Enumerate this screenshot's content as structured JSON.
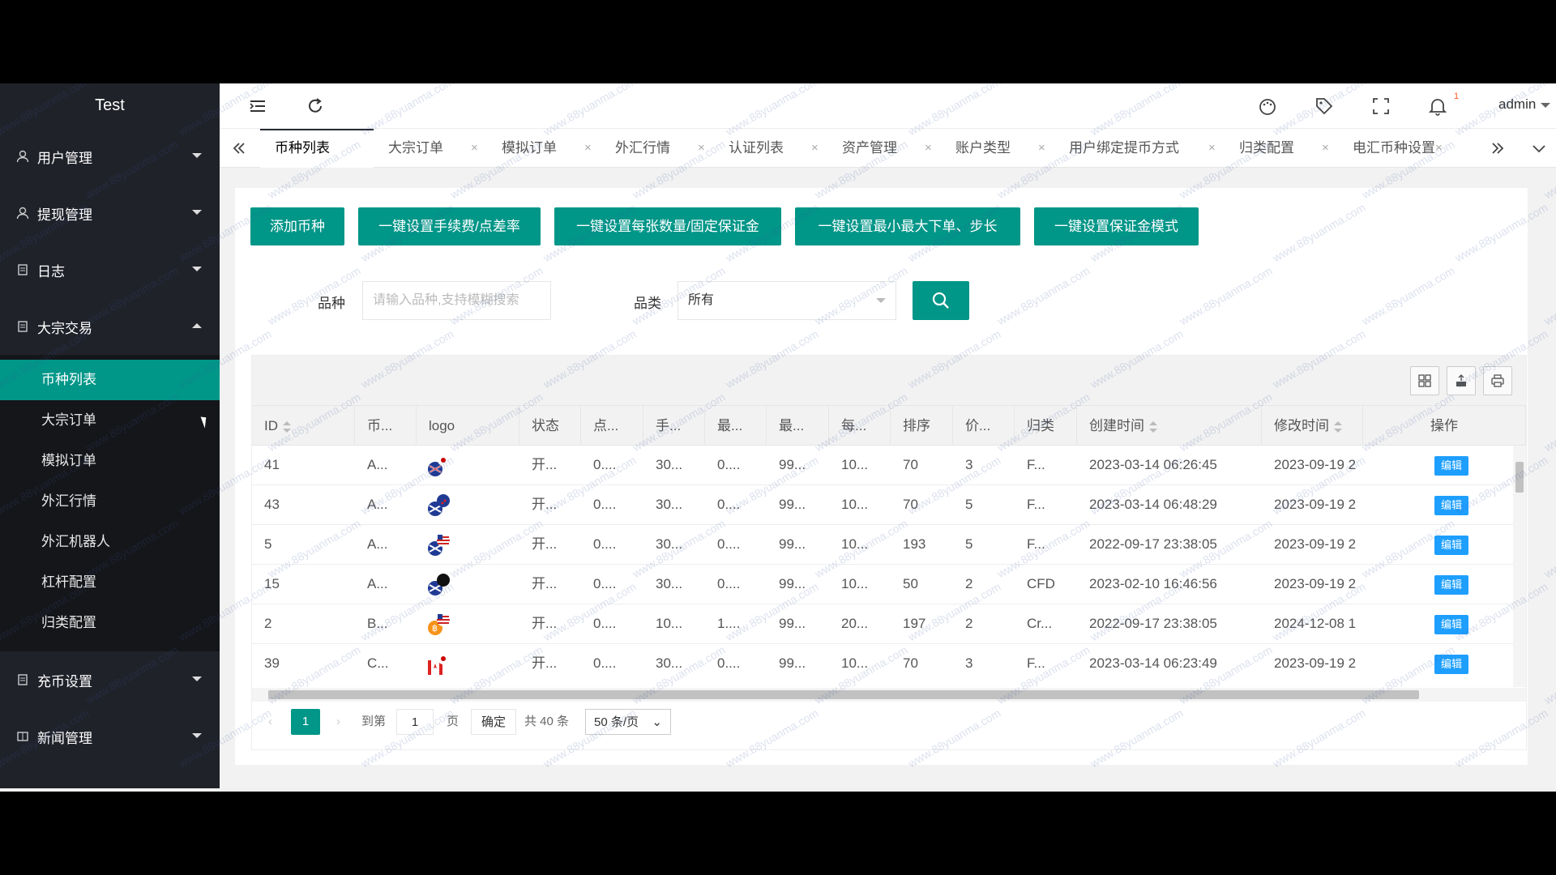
{
  "app_title": "Test",
  "sidebar": {
    "groups_top": [
      {
        "label": "用户管理",
        "icon": "user-icon"
      },
      {
        "label": "提现管理",
        "icon": "user-icon"
      },
      {
        "label": "日志",
        "icon": "document-icon"
      },
      {
        "label": "大宗交易",
        "icon": "document-icon"
      }
    ],
    "sub_items": [
      "币种列表",
      "大宗订单",
      "模拟订单",
      "外汇行情",
      "外汇机器人",
      "杠杆配置",
      "归类配置"
    ],
    "active_sub": "币种列表",
    "groups_bottom": [
      {
        "label": "充币设置",
        "icon": "document-icon"
      },
      {
        "label": "新闻管理",
        "icon": "news-icon"
      }
    ]
  },
  "header": {
    "user": "admin",
    "notification_count": "1"
  },
  "tabs": [
    "币种列表",
    "大宗订单",
    "模拟订单",
    "外汇行情",
    "认证列表",
    "资产管理",
    "账户类型",
    "用户绑定提币方式",
    "归类配置",
    "电汇币种设置"
  ],
  "actions": {
    "add": "添加币种",
    "fee": "一键设置手续费/点差率",
    "margin": "一键设置每张数量/固定保证金",
    "order": "一键设置最小最大下单、步长",
    "mode": "一键设置保证金模式"
  },
  "filters": {
    "variety_label": "品种",
    "variety_placeholder": "请输入品种,支持模糊搜索",
    "category_label": "品类",
    "category_value": "所有"
  },
  "table": {
    "columns": [
      "ID",
      "币...",
      "logo",
      "状态",
      "点...",
      "手...",
      "最...",
      "最...",
      "每...",
      "排序",
      "价...",
      "归类",
      "创建时间",
      "修改时间",
      "操作"
    ],
    "edit_label": "编辑",
    "rows": [
      {
        "id": "41",
        "coin": "A...",
        "status": "开...",
        "point": "0....",
        "fee": "30...",
        "min": "0....",
        "max": "99...",
        "each": "10...",
        "sort": "70",
        "price": "3",
        "cat": "F...",
        "created": "2023-03-14 06:26:45",
        "modified": "2023-09-19 2",
        "flag": "au-jp"
      },
      {
        "id": "43",
        "coin": "A...",
        "status": "开...",
        "point": "0....",
        "fee": "30...",
        "min": "0....",
        "max": "99...",
        "each": "10...",
        "sort": "70",
        "price": "5",
        "cat": "F...",
        "created": "2023-03-14 06:48:29",
        "modified": "2023-09-19 2",
        "flag": "au-nz"
      },
      {
        "id": "5",
        "coin": "A...",
        "status": "开...",
        "point": "0....",
        "fee": "30...",
        "min": "0....",
        "max": "99...",
        "each": "10...",
        "sort": "193",
        "price": "5",
        "cat": "F...",
        "created": "2022-09-17 23:38:05",
        "modified": "2023-09-19 2",
        "flag": "au-us"
      },
      {
        "id": "15",
        "coin": "A...",
        "status": "开...",
        "point": "0....",
        "fee": "30...",
        "min": "0....",
        "max": "99...",
        "each": "10...",
        "sort": "50",
        "price": "2",
        "cat": "CFD",
        "created": "2023-02-10 16:46:56",
        "modified": "2023-09-19 2",
        "flag": "au-black"
      },
      {
        "id": "2",
        "coin": "B...",
        "status": "开...",
        "point": "0....",
        "fee": "10...",
        "min": "1....",
        "max": "99...",
        "each": "20...",
        "sort": "197",
        "price": "2",
        "cat": "Cr...",
        "created": "2022-09-17 23:38:05",
        "modified": "2024-12-08 1",
        "flag": "btc-us"
      },
      {
        "id": "39",
        "coin": "C...",
        "status": "开...",
        "point": "0....",
        "fee": "30...",
        "min": "0....",
        "max": "99...",
        "each": "10...",
        "sort": "70",
        "price": "3",
        "cat": "F...",
        "created": "2023-03-14 06:23:49",
        "modified": "2023-09-19 2",
        "flag": "ca-jp"
      }
    ]
  },
  "pager": {
    "current": "1",
    "goto_label": "到第",
    "goto_value": "1",
    "page_unit": "页",
    "confirm": "确定",
    "total": "共 40 条",
    "per_page": "50 条/页"
  },
  "watermark": "www.88yuanma.com"
}
